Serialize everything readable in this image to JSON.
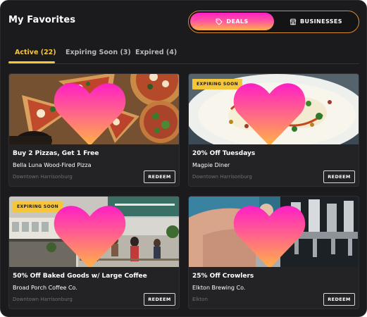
{
  "header": {
    "title": "My Favorites"
  },
  "toggle": {
    "deals_label": "DEALS",
    "businesses_label": "BUSINESSES"
  },
  "tabs": [
    {
      "label": "Active (22)",
      "active": true
    },
    {
      "label": "Expiring Soon (3)",
      "active": false
    },
    {
      "label": "Expired (4)",
      "active": false
    }
  ],
  "cards": [
    {
      "deal": "Buy 2 Pizzas, Get 1 Free",
      "business": "Bella Luna Wood-Fired Pizza",
      "location": "Downtown Harrisonburg",
      "badge": "",
      "redeem": "REDEEM",
      "image": "pizza-photo"
    },
    {
      "deal": "20% Off Tuesdays",
      "business": "Magpie Diner",
      "location": "Downtown Harrisonburg",
      "badge": "EXPIRING SOON",
      "redeem": "REDEEM",
      "image": "diner-plate-photo"
    },
    {
      "deal": "50% Off Baked Goods w/ Large Coffee",
      "business": "Broad Porch Coffee Co.",
      "location": "Downtown Harrisonburg",
      "badge": "EXPIRING SOON",
      "redeem": "REDEEM",
      "image": "coffee-shop-photo"
    },
    {
      "deal": "25% Off Crowlers",
      "business": "Elkton Brewing Co.",
      "location": "Elkton",
      "badge": "",
      "redeem": "REDEEM",
      "image": "beer-taps-photo"
    }
  ],
  "colors": {
    "background": "#1b1b1d",
    "card": "#232326",
    "accent_yellow": "#f6c63a",
    "gradient_pink": "#ff1fc6",
    "gradient_orange": "#ffb347"
  }
}
